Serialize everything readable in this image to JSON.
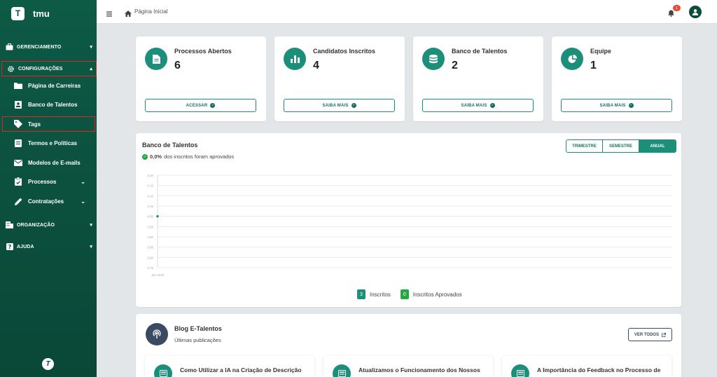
{
  "brand": {
    "letter": "T",
    "name": "tmu"
  },
  "sidebar": {
    "sections": [
      {
        "label": "GERENCIAMENTO",
        "icon": "briefcase-icon",
        "chevron": "▾"
      },
      {
        "label": "CONFIGURAÇÕES",
        "icon": "gear-icon",
        "chevron": "▴"
      },
      {
        "label": "ORGANIZAÇÃO",
        "icon": "building-icon",
        "chevron": "▾"
      },
      {
        "label": "AJUDA",
        "icon": "help-icon",
        "chevron": "▾"
      }
    ],
    "items": [
      {
        "label": "Página de Carreiras",
        "icon": "folder-icon"
      },
      {
        "label": "Banco de Talentos",
        "icon": "contact-card-icon"
      },
      {
        "label": "Tags",
        "icon": "tag-icon"
      },
      {
        "label": "Termos e Políticas",
        "icon": "document-icon"
      },
      {
        "label": "Modelos de E-mails",
        "icon": "mail-icon"
      },
      {
        "label": "Processos",
        "icon": "clipboard-icon",
        "chevron": "⌄"
      },
      {
        "label": "Contratações",
        "icon": "pencil-icon",
        "chevron": "⌄"
      }
    ],
    "footer_logo": "T"
  },
  "topbar": {
    "breadcrumb": "Página Inicial",
    "notification_count": "1"
  },
  "stats": [
    {
      "title": "Processos Abertos",
      "value": "6",
      "button": "ACESSAR",
      "icon": "file-icon"
    },
    {
      "title": "Candidatos Inscritos",
      "value": "4",
      "button": "SAIBA MAIS",
      "icon": "bar-chart-icon"
    },
    {
      "title": "Banco de Talentos",
      "value": "2",
      "button": "SAIBA MAIS",
      "icon": "database-icon"
    },
    {
      "title": "Equipe",
      "value": "1",
      "button": "SAIBA MAIS",
      "icon": "pie-chart-icon"
    }
  ],
  "chart_card": {
    "title": "Banco de Talentos",
    "subtitle_value": "0,0%",
    "subtitle_text": "dos inscritos foram aprovados",
    "periods": [
      "TRIMESTRE",
      "SEMESTRE",
      "ANUAL"
    ],
    "active_period": "ANUAL"
  },
  "chart_data": {
    "type": "line",
    "x": [
      "Jan 2025"
    ],
    "series": [
      {
        "name": "Inscritos",
        "values": [
          4
        ],
        "color": "#1b8f7a"
      },
      {
        "name": "Inscritos Aprovados",
        "values": [
          0
        ],
        "color": "#28a745"
      }
    ],
    "yticks": [
      "4,20",
      "4,15",
      "4,10",
      "4,05",
      "4,00",
      "3,95",
      "3,90",
      "3,85",
      "3,80",
      "3,75"
    ],
    "ylim": [
      3.75,
      4.2
    ],
    "legend": [
      {
        "count": "3",
        "label": "Inscritos",
        "color": "#1b8f7a"
      },
      {
        "count": "0",
        "label": "Inscritos Aprovados",
        "color": "#28a745"
      }
    ]
  },
  "blog": {
    "title": "Blog E-Talentos",
    "subtitle": "Últimas publicações",
    "view_all": "VER TODOS",
    "posts": [
      {
        "title": "Como Utilizar a IA na Criação de Descrição"
      },
      {
        "title": "Atualizamos o Funcionamento dos Nossos"
      },
      {
        "title": "A Importância do Feedback no Processo de"
      }
    ]
  },
  "colors": {
    "primary": "#1b8f7a",
    "sidebar": "#0b4d3b",
    "blog": "#3a4a63",
    "highlight": "#d62828"
  }
}
